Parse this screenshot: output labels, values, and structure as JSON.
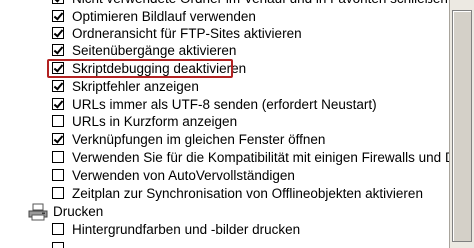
{
  "options": [
    {
      "label": "Nicht verwendete Ordner im Verlauf und in Favoriten schließen",
      "checked": true,
      "indent": true
    },
    {
      "label": "Optimieren Bildlauf verwenden",
      "checked": true,
      "indent": true
    },
    {
      "label": "Ordneransicht für FTP-Sites aktivieren",
      "checked": true,
      "indent": true
    },
    {
      "label": "Seitenübergänge aktivieren",
      "checked": true,
      "indent": true
    },
    {
      "label": "Skriptdebugging deaktivieren",
      "checked": true,
      "indent": true,
      "highlighted": true
    },
    {
      "label": "Skriptfehler anzeigen",
      "checked": true,
      "indent": true
    },
    {
      "label": "URLs immer als UTF-8 senden (erfordert Neustart)",
      "checked": true,
      "indent": true
    },
    {
      "label": "URLs in Kurzform anzeigen",
      "checked": false,
      "indent": true
    },
    {
      "label": "Verknüpfungen im gleichen Fenster öffnen",
      "checked": true,
      "indent": true
    },
    {
      "label": "Verwenden Sie für die Kompatibilität mit einigen Firewalls und D",
      "checked": false,
      "indent": true
    },
    {
      "label": "Verwenden von AutoVervollständigen",
      "checked": false,
      "indent": true
    },
    {
      "label": "Zeitplan zur Synchronisation von Offlineobjekten aktivieren",
      "checked": false,
      "indent": true
    }
  ],
  "category": {
    "label": "Drucken",
    "icon": "printer-icon"
  },
  "category_options": [
    {
      "label": "Hintergrundfarben und -bilder drucken",
      "checked": false
    }
  ]
}
